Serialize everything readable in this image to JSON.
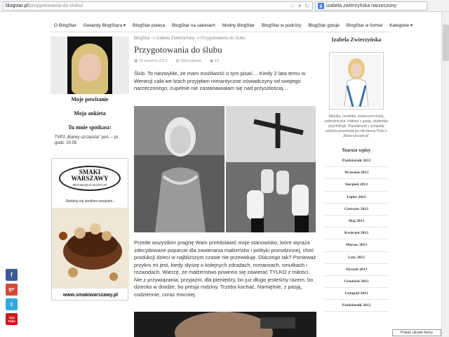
{
  "browser": {
    "url_domain": "blogstar.pl",
    "url_path": "/przygotowania-do-slubu/",
    "search_value": "izabela zwierzyńska narzeczony"
  },
  "nav": [
    "O BlogStar",
    "Gwiazdy BlogStara ▾",
    "BlogStar poleca",
    "BlogStar na salonach",
    "Modny BlogStar",
    "BlogStar w podróży",
    "BlogStar gotuje",
    "BlogStar w formie",
    "Kategorie ▾"
  ],
  "left": {
    "links": [
      "Moje powitanie",
      "Moja ankieta",
      "Tu mnie spotkasz:"
    ],
    "tv": "TVP2 „Barwy szczęścia” pon. – pt. godz. 20.05"
  },
  "ad": {
    "brand1": "SMAKI",
    "brand2": "WARSZAWY",
    "sub": "PRZYSMAKI & SŁODYCZE",
    "tagline": "Delektuj się słodkimi smakami...",
    "url": "www.smakiwarszawy.pl"
  },
  "post": {
    "breadcrumb": "BlogStar -> Izabela Zwierzyńska -> Przygotowania do ślubu",
    "title": "Przygotowania do ślubu",
    "date": "13 sierpnia 2013",
    "category": "Obyczajowe",
    "comments": "19",
    "intro": "Ślub. To niezwykłe, że mam możliwość o tym pisać… Kiedy 2 lata temu w Wenecji cała we łzach przyjęłam romantyczne oświadczyny od swojego narzeczonego, zupełnie nie zastanawiałam się nad przyszłością…",
    "body": "Przede wszystkim pragnę Wam przedstawić moje stanowisko, które wyraża zdecydowane poparcie dla zawierania małżeństw i polityki prorodzinnej, choć produkcji dzieci w najbliższym czasie nie przewiduję. Dlaczego tak? Ponieważ przykro mi jest, kiedy słyszę o kolejnych zdradach, romansach, smutkach i rozwodach. Wierzę, że małżeństwo powinno się zawierać TYLKO z miłości. Nie z przywiązania, przyjaźni, dla pieniędzy, bo już długo jesteśmy razem, bo dziecko w drodze, bo presja rodziny. Trzeba kochać. Namiętnie, z pasją, codziennie, coraz mocniej."
  },
  "sidebar": {
    "name": "Izabela Zwierzyńska",
    "bio": "Aktorka, modelka, znawczyni mody, podróżniczka, kobieta z pasją, studentka psychologii. Popularność i sympatię widzów przyniosła jej rola Iwony Pyrki z „Barw szczęścia”.",
    "archive_title": "Starsze wpisy",
    "archive": [
      "Październik 2013",
      "Wrzesień 2013",
      "Sierpień 2013",
      "Lipiec 2013",
      "Czerwiec 2013",
      "Maj 2013",
      "Kwiecień 2013",
      "Marzec 2013",
      "Luty 2013",
      "Styczeń 2013",
      "Grudzień 2012",
      "Listopad 2012",
      "Październik 2012"
    ]
  },
  "social": [
    "f",
    "g+",
    "t",
    "You Tube"
  ],
  "tooltip": "Pokaż ukryte ikony"
}
